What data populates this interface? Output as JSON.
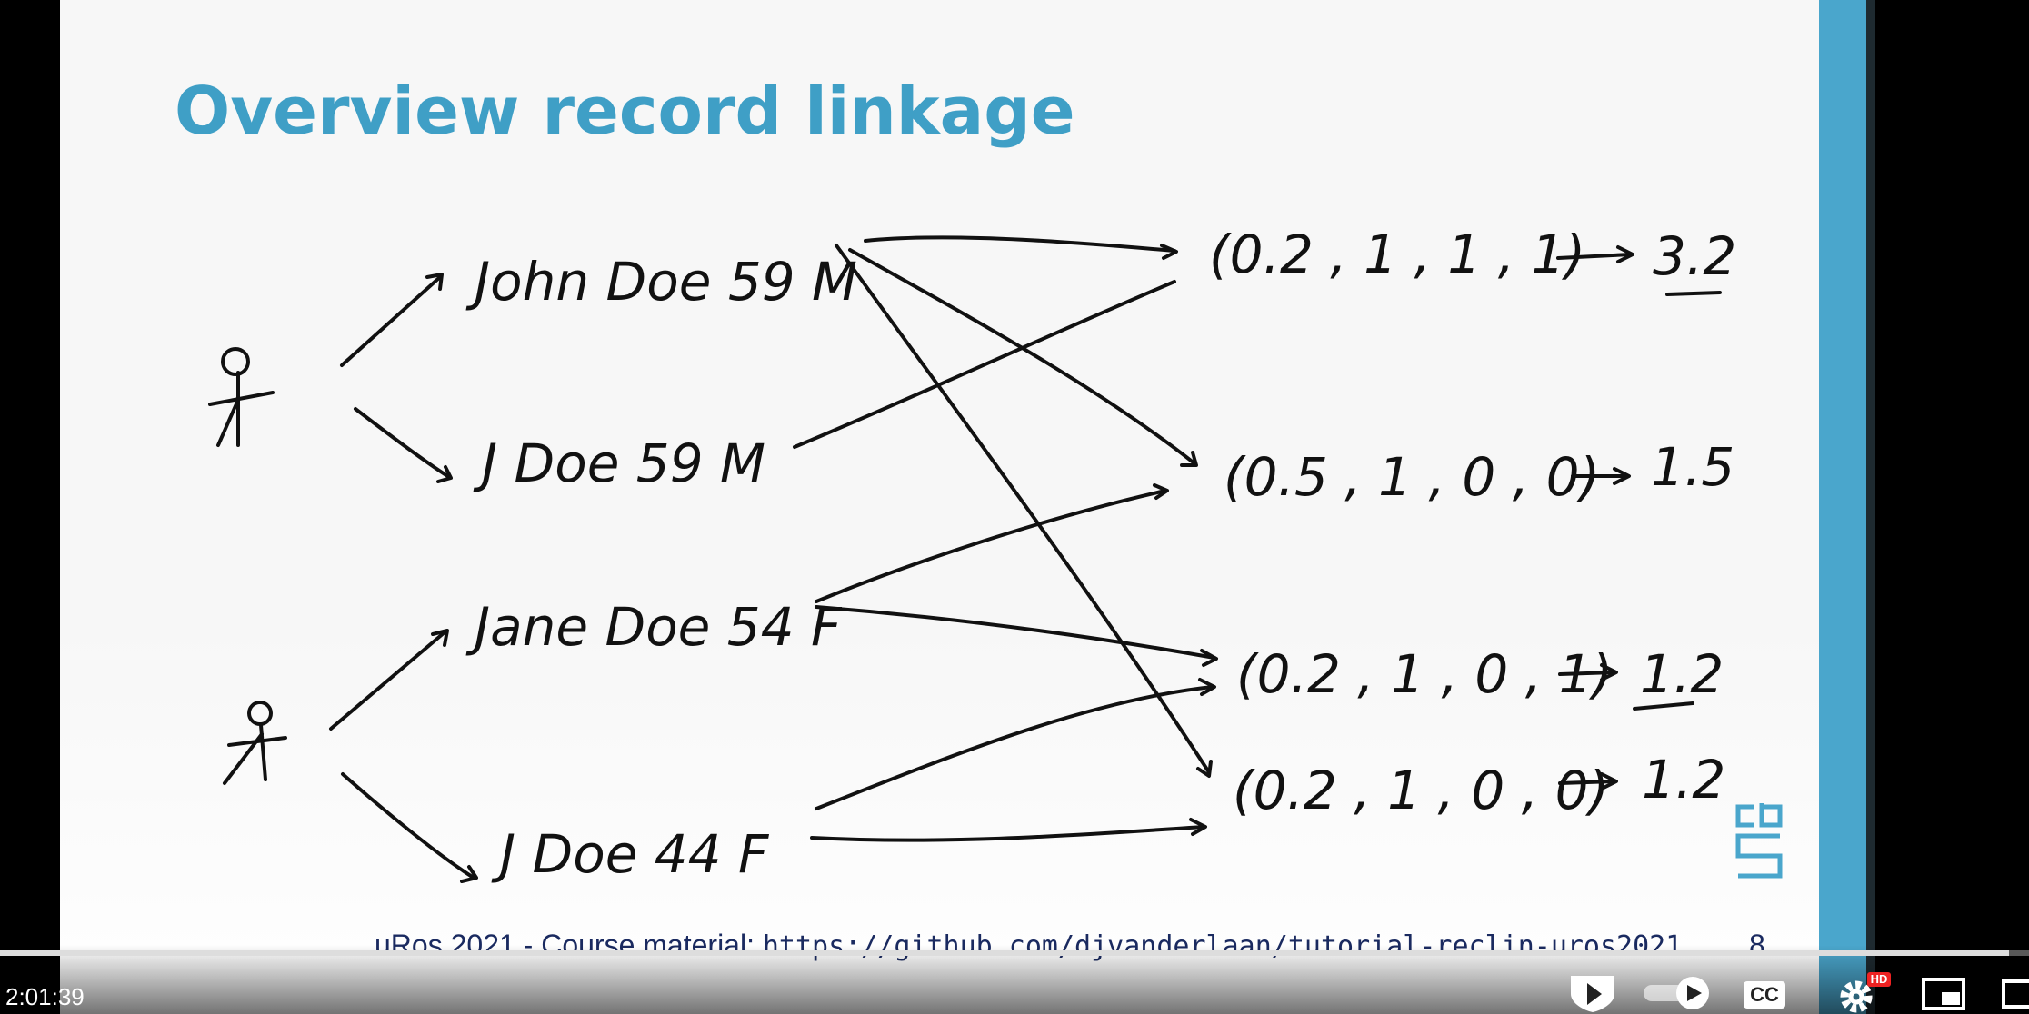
{
  "slide": {
    "title": "Overview record linkage",
    "records": [
      "John Doe 59 M",
      "J Doe 59 M",
      "Jane Doe 54 F",
      "J Doe 44 F"
    ],
    "vectors": [
      "(0.2 , 1 , 1 , 1)",
      "(0.5 , 1 , 0 , 0)",
      "(0.2 , 1 , 0 , 1)",
      "(0.2 , 1 , 0 , 0)"
    ],
    "scores": [
      "3.2",
      "1.5",
      "1.2",
      "1.2"
    ],
    "footer_text": "uRos 2021 - Course material: ",
    "footer_url": "https://github.com/djvanderlaan/tutorial-reclin-uros2021",
    "page_number": "8",
    "logo_text": "cbs",
    "accent_color": "#4aa6cc"
  },
  "player": {
    "time": "2:01:39",
    "progress": 0.99,
    "hd_badge": "HD",
    "cc_label": "CC",
    "icons": [
      "autoplay-toggle-icon",
      "cc-icon",
      "settings-gear-icon",
      "miniplayer-icon"
    ]
  }
}
